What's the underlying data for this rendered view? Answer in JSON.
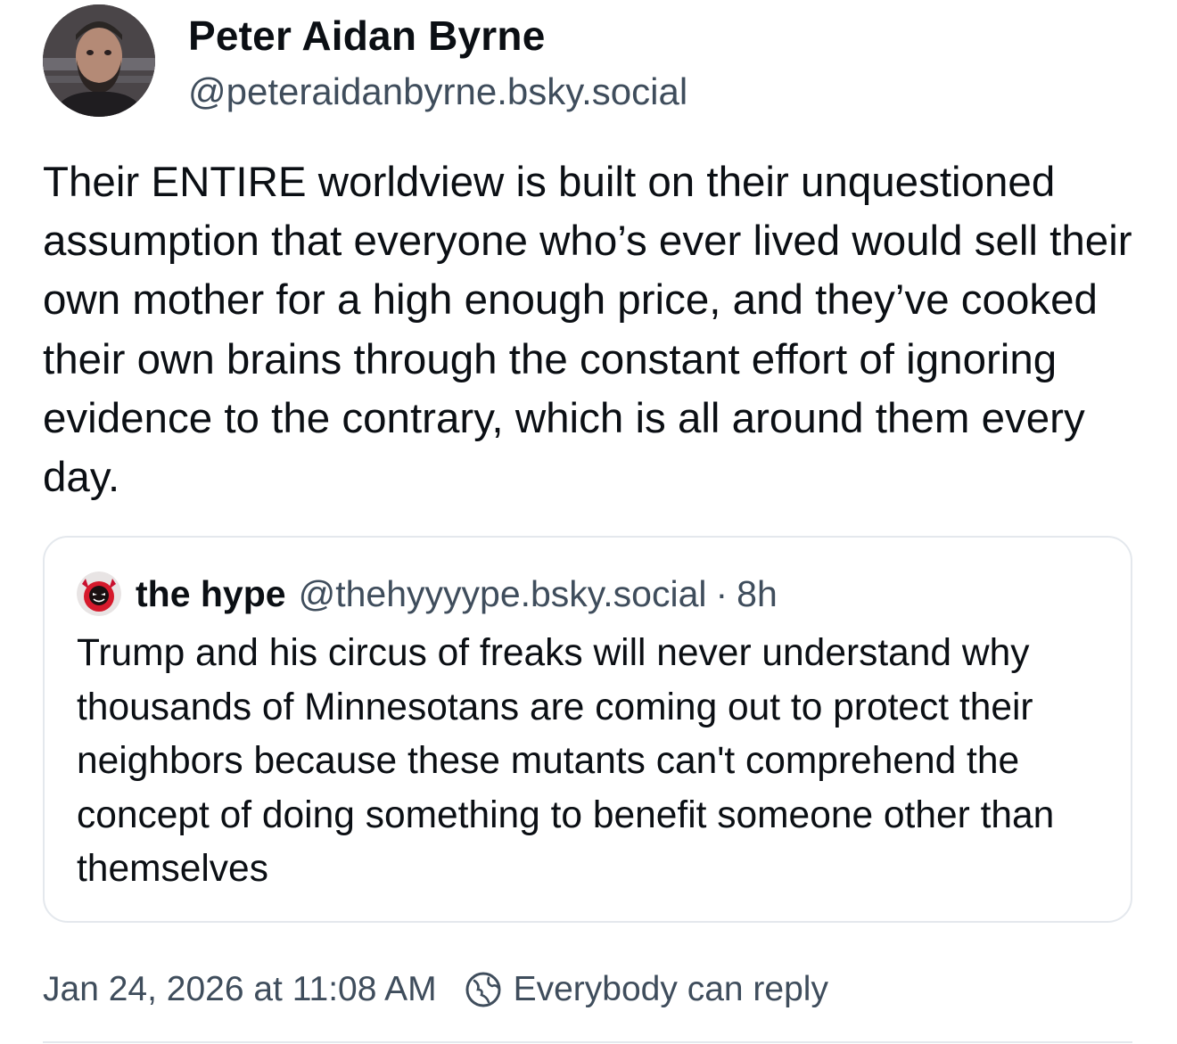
{
  "post": {
    "author": {
      "display_name": "Peter Aidan Byrne",
      "handle": "@peteraidanbyrne.bsky.social",
      "avatar_icon": "profile-photo"
    },
    "text": "Their ENTIRE worldview is built on their unquestioned assumption that everyone who’s ever lived would sell their own mother for a high enough price, and they’ve cooked their own brains through the constant effort of ignoring evidence to the contrary, which is all around them every day.",
    "quoted_post": {
      "author": {
        "display_name": "the hype",
        "handle": "@thehyyyype.bsky.social",
        "avatar_icon": "devil-emoji-avatar"
      },
      "separator": "·",
      "time_ago": "8h",
      "text": "Trump and his circus of freaks will never understand why thousands of Minnesotans are coming out to protect their neighbors because these mutants can't comprehend the concept of doing something to benefit someone other than themselves"
    },
    "footer": {
      "timestamp": "Jan 24, 2026 at 11:08 AM",
      "reply_setting": {
        "icon": "globe-icon",
        "label": "Everybody can reply"
      }
    }
  },
  "colors": {
    "text_primary": "#0b0f14",
    "text_secondary": "#3f4d5c",
    "border": "#e4e8ed",
    "background": "#ffffff"
  }
}
